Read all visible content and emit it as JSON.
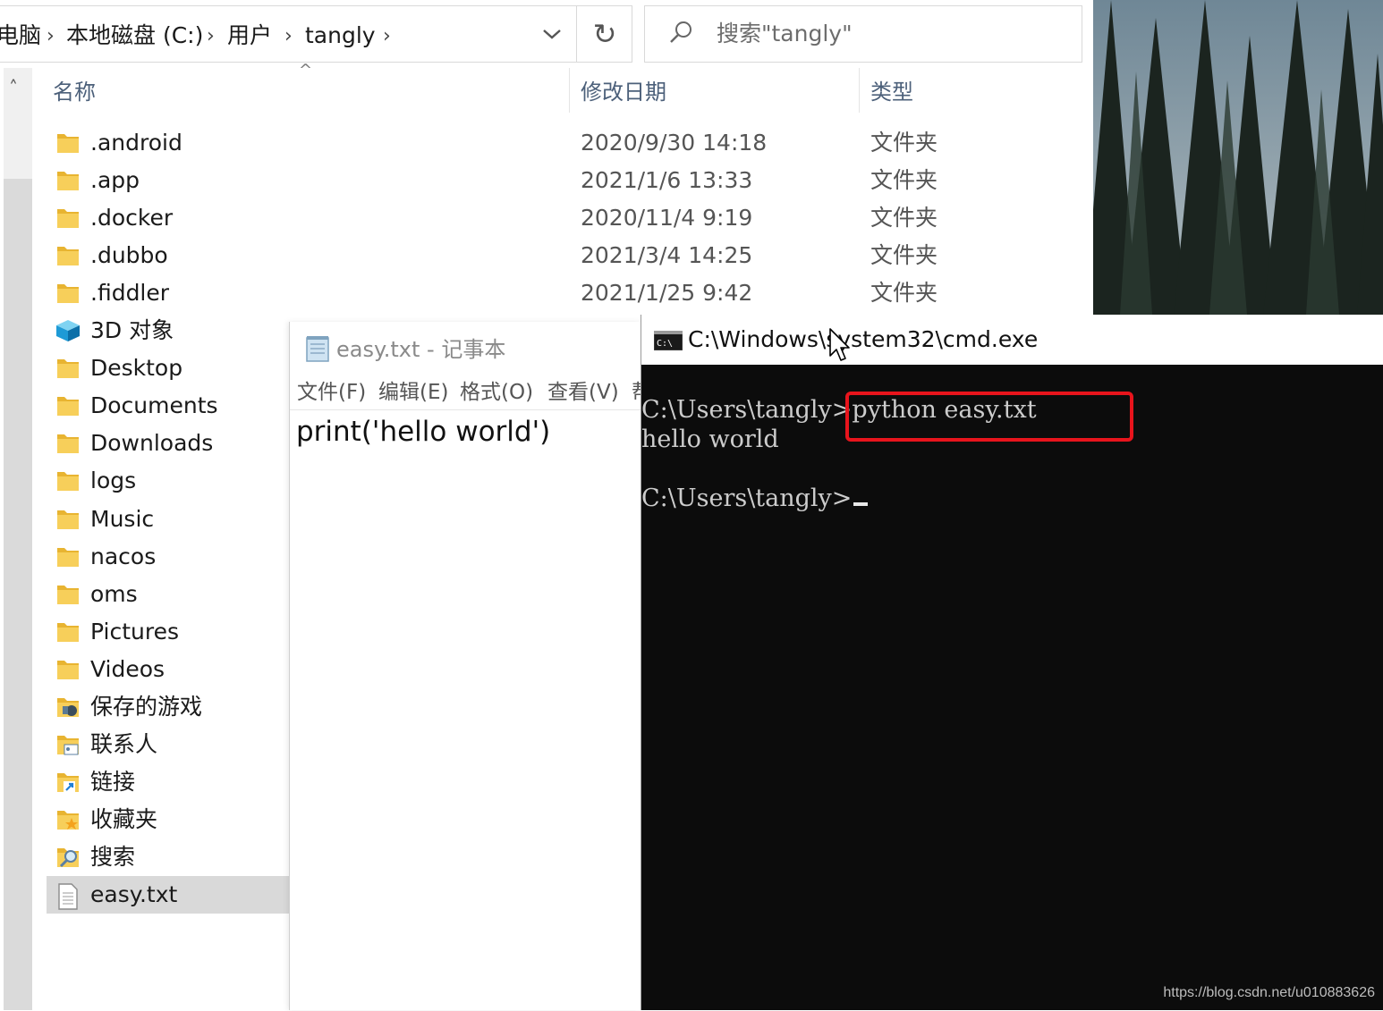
{
  "explorer": {
    "breadcrumb": [
      "电脑",
      "本地磁盘 (C:)",
      "用户",
      "tangly"
    ],
    "search_placeholder": "搜索\"tangly\"",
    "columns": {
      "name": "名称",
      "date": "修改日期",
      "type": "类型"
    },
    "rows": [
      {
        "name": ".android",
        "date": "2020/9/30 14:18",
        "type": "文件夹",
        "icon": "folder-icon"
      },
      {
        "name": ".app",
        "date": "2021/1/6 13:33",
        "type": "文件夹",
        "icon": "folder-icon"
      },
      {
        "name": ".docker",
        "date": "2020/11/4 9:19",
        "type": "文件夹",
        "icon": "folder-icon"
      },
      {
        "name": ".dubbo",
        "date": "2021/3/4 14:25",
        "type": "文件夹",
        "icon": "folder-icon"
      },
      {
        "name": ".fiddler",
        "date": "2021/1/25 9:42",
        "type": "文件夹",
        "icon": "folder-icon"
      },
      {
        "name": "3D 对象",
        "date": "",
        "type": "",
        "icon": "3d-objects-icon"
      },
      {
        "name": "Desktop",
        "date": "",
        "type": "",
        "icon": "folder-icon"
      },
      {
        "name": "Documents",
        "date": "",
        "type": "",
        "icon": "folder-icon"
      },
      {
        "name": "Downloads",
        "date": "",
        "type": "",
        "icon": "folder-icon"
      },
      {
        "name": "logs",
        "date": "",
        "type": "",
        "icon": "folder-icon"
      },
      {
        "name": "Music",
        "date": "",
        "type": "",
        "icon": "folder-icon"
      },
      {
        "name": "nacos",
        "date": "",
        "type": "",
        "icon": "folder-icon"
      },
      {
        "name": "oms",
        "date": "",
        "type": "",
        "icon": "folder-icon"
      },
      {
        "name": "Pictures",
        "date": "",
        "type": "",
        "icon": "folder-icon"
      },
      {
        "name": "Videos",
        "date": "",
        "type": "",
        "icon": "folder-icon"
      },
      {
        "name": "保存的游戏",
        "date": "",
        "type": "",
        "icon": "saved-games-icon"
      },
      {
        "name": "联系人",
        "date": "",
        "type": "",
        "icon": "contacts-icon"
      },
      {
        "name": "链接",
        "date": "",
        "type": "",
        "icon": "links-icon"
      },
      {
        "name": "收藏夹",
        "date": "",
        "type": "",
        "icon": "favorites-icon"
      },
      {
        "name": "搜索",
        "date": "",
        "type": "",
        "icon": "searches-icon"
      },
      {
        "name": "easy.txt",
        "date": "",
        "type": "",
        "icon": "text-file-icon",
        "selected": true
      }
    ]
  },
  "notepad": {
    "title": "easy.txt - 记事本",
    "menu": [
      "文件(F)",
      "编辑(E)",
      "格式(O)",
      "查看(V)",
      "帮"
    ],
    "content": "print('hello world')"
  },
  "cmd": {
    "title": "C:\\Windows\\system32\\cmd.exe",
    "lines": [
      "C:\\Users\\tangly>python easy.txt",
      "hello world",
      "",
      "C:\\Users\\tangly>"
    ],
    "highlight_color": "#e8141c"
  },
  "watermark": "https://blog.csdn.net/u010883626",
  "colors": {
    "folder": "#f2c94c",
    "header_text": "#4c607a",
    "selected_row": "#d9d9d9",
    "console_bg": "#0c0c0c"
  }
}
